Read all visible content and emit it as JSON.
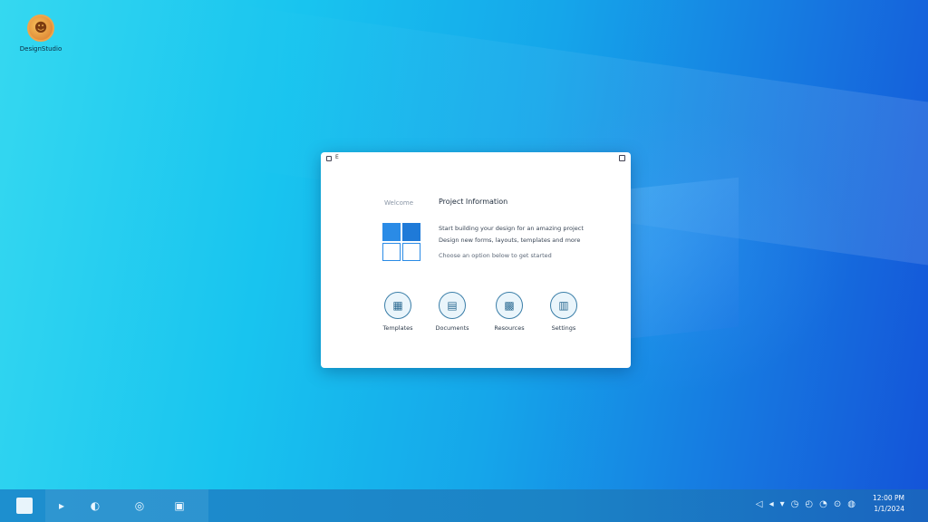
{
  "desktop": {
    "icon_label": "DesignStudio",
    "icon_glyph": "☻"
  },
  "dialog": {
    "title": "E",
    "side_label": "Welcome",
    "heading": "Project Information",
    "desc_line1": "Start building your design for an amazing project",
    "desc_line2": "Design new forms, layouts, templates and more",
    "desc_line3": "Choose an option below to get started",
    "features": [
      {
        "label": "Templates",
        "icon": "template-icon",
        "glyph": "▦"
      },
      {
        "label": "Documents",
        "icon": "document-icon",
        "glyph": "▤"
      },
      {
        "label": "Resources",
        "icon": "resource-icon",
        "glyph": "▩"
      },
      {
        "label": "Settings",
        "icon": "settings-icon",
        "glyph": "▥"
      }
    ]
  },
  "taskbar": {
    "apps": [
      {
        "name": "file-explorer-icon",
        "glyph": "▸"
      },
      {
        "name": "edge-icon",
        "glyph": "◐"
      },
      {
        "name": "chrome-icon",
        "glyph": "◎"
      },
      {
        "name": "store-icon",
        "glyph": "▣"
      }
    ],
    "tray_icons": [
      "◁",
      "◂",
      "▾",
      "◷",
      "◴",
      "◔",
      "⊙",
      "◍"
    ],
    "time": "12:00 PM",
    "date": "1/1/2024"
  },
  "colors": {
    "accent": "#2a8be6",
    "taskbar": "#1b83c6"
  }
}
